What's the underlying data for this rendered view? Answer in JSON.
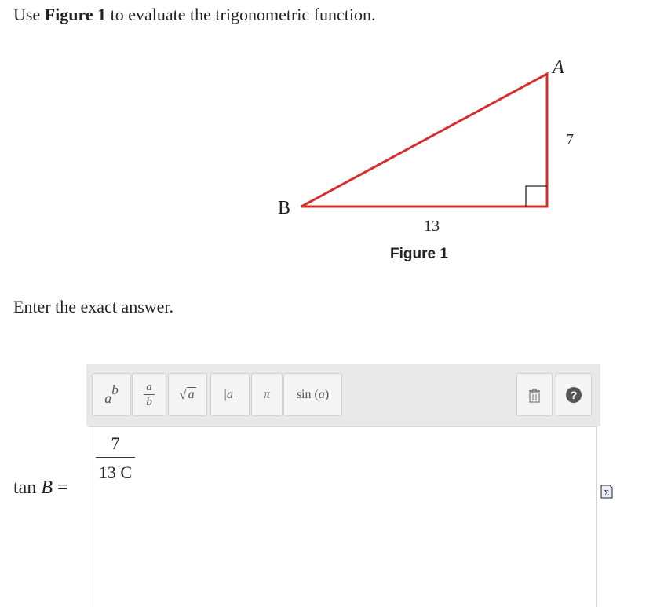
{
  "question": {
    "prefix": "Use ",
    "figure_ref": "Figure 1",
    "suffix": " to evaluate the trigonometric function."
  },
  "figure": {
    "caption": "Figure 1",
    "vertex_a": "A",
    "vertex_b": "B",
    "side_vertical": "7",
    "side_horizontal": "13",
    "stroke_color": "#d32f2f"
  },
  "instruction": "Enter the exact answer.",
  "toolbar": {
    "superscript_base": "a",
    "superscript_exp": "b",
    "fraction_num": "a",
    "fraction_den": "b",
    "sqrt_label": "a",
    "abs_label": "|a|",
    "pi_label": "π",
    "sin_label": "sin",
    "sin_arg": "a",
    "trash_icon": "trash-icon",
    "help_icon": "question-icon"
  },
  "answer": {
    "lhs_fn": "tan ",
    "lhs_var": "B",
    "lhs_eq": " =",
    "numerator": "7",
    "denominator": "13 C"
  },
  "icons": {
    "sum": "sigma-icon"
  }
}
